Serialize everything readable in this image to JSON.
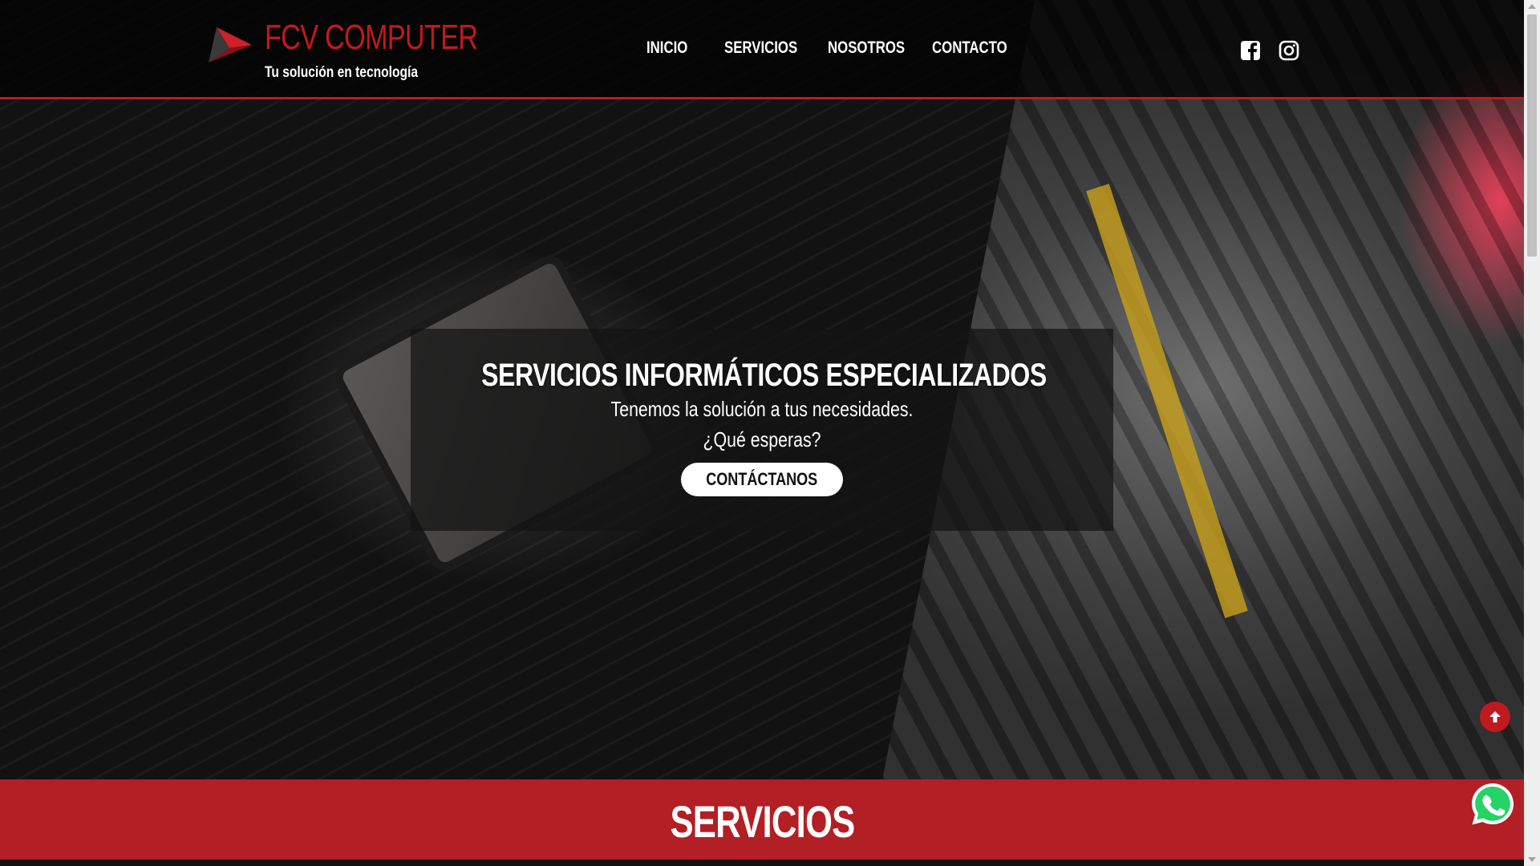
{
  "header": {
    "brand": "FCV COMPUTER",
    "tagline": "Tu solución en tecnología",
    "nav": [
      {
        "label": "INICIO"
      },
      {
        "label": "SERVICIOS"
      },
      {
        "label": "NOSOTROS"
      },
      {
        "label": "CONTACTO"
      }
    ],
    "social": [
      {
        "icon": "facebook-icon"
      },
      {
        "icon": "instagram-icon"
      }
    ]
  },
  "hero": {
    "title": "SERVICIOS INFORMÁTICOS ESPECIALIZADOS",
    "line1": "Tenemos la solución a tus necesidades.",
    "line2": "¿Qué esperas?",
    "button": "CONTÁCTANOS"
  },
  "services": {
    "title": "SERVICIOS"
  },
  "floating": {
    "scroll_top_icon": "arrow-up-icon",
    "whatsapp_icon": "whatsapp-icon"
  },
  "colors": {
    "accent": "#c0191f",
    "band": "#b21f24"
  }
}
